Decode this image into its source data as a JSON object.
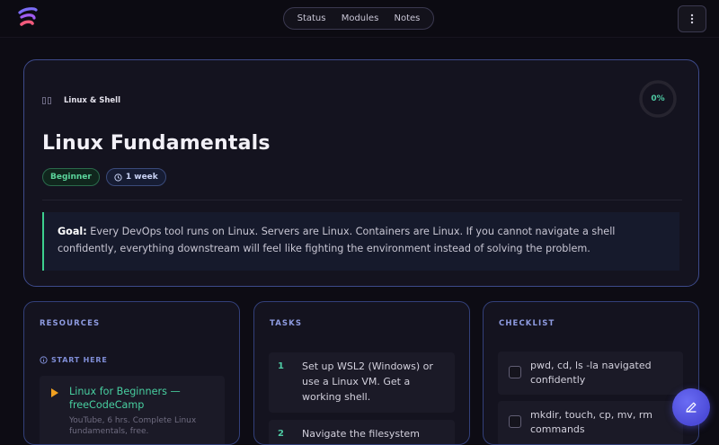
{
  "nav": {
    "links": [
      "Status",
      "Modules",
      "Notes"
    ],
    "menu_icon": "vertical-ellipsis-icon"
  },
  "hero": {
    "category": "Linux & Shell",
    "title": "Linux Fundamentals",
    "progress": "0%",
    "progress_value": 0,
    "level_tag": "Beginner",
    "duration_tag": "1 week",
    "goal_label": "Goal:",
    "goal_text": " Every DevOps tool runs on Linux. Servers are Linux. Containers are Linux. If you cannot navigate a shell confidently, everything downstream will feel like fighting the environment instead of solving the problem."
  },
  "resources": {
    "heading": "RESOURCES",
    "start_here": "START HERE",
    "items": [
      {
        "title_line1": "Linux for Beginners —",
        "title_line2": "freeCodeCamp",
        "desc_line1": "YouTube, 6 hrs. Complete Linux",
        "desc_line2": "fundamentals, free."
      }
    ]
  },
  "tasks": {
    "heading": "TASKS",
    "items": [
      {
        "num": "1",
        "line1": "Set up WSL2 (Windows) or",
        "line2": "use a Linux VM. Get a",
        "line3": "working shell."
      },
      {
        "num": "2",
        "line1": "Navigate the filesystem"
      }
    ]
  },
  "checklist": {
    "heading": "CHECKLIST",
    "items": [
      {
        "line1": "pwd, cd, ls -la navigated",
        "line2": "confidently"
      },
      {
        "line1": "mkdir, touch, cp, mv, rm",
        "line2": "commands"
      }
    ]
  },
  "colors": {
    "accent_green": "#4ec9a3",
    "accent_blue": "#8e9be0",
    "border_blue": "#3d4a8a",
    "fab": "#5a5ae6"
  }
}
